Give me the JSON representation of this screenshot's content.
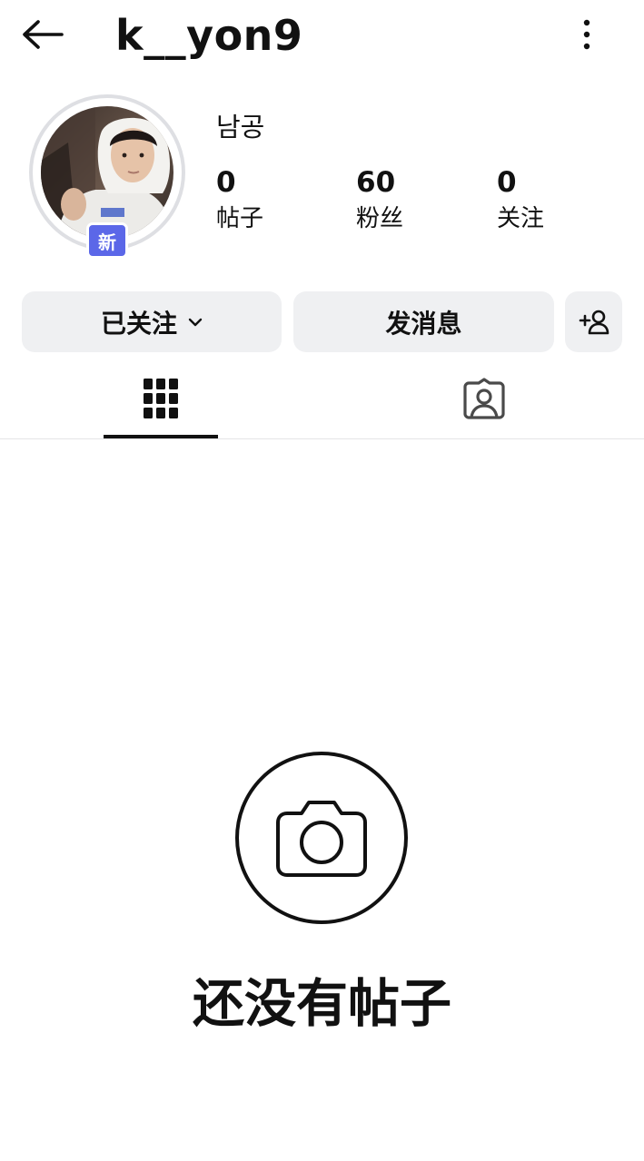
{
  "header": {
    "username": "k__yon9",
    "back_icon": "arrow-left-icon",
    "more_icon": "more-vertical-icon"
  },
  "profile": {
    "display_name": "남공",
    "new_badge": "新",
    "stats": [
      {
        "value": "0",
        "label": "帖子"
      },
      {
        "value": "60",
        "label": "粉丝"
      },
      {
        "value": "0",
        "label": "关注"
      }
    ]
  },
  "actions": {
    "following_label": "已关注",
    "message_label": "发消息",
    "suggest_icon": "add-person-icon"
  },
  "tabs": [
    {
      "name": "grid",
      "icon": "grid-icon",
      "active": true
    },
    {
      "name": "tagged",
      "icon": "tagged-person-icon",
      "active": false
    }
  ],
  "empty_state": {
    "icon": "camera-icon",
    "text": "还没有帖子"
  },
  "colors": {
    "badge": "#5b67e8",
    "button_bg": "#eff0f2",
    "text": "#111111"
  }
}
